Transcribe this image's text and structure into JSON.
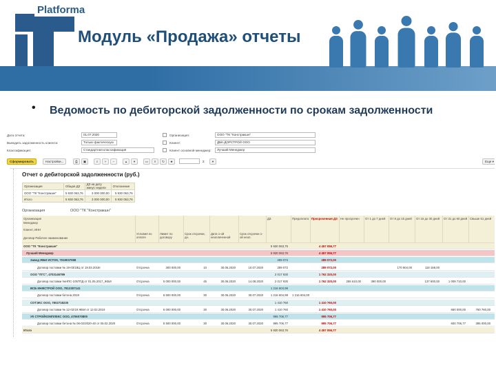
{
  "brand": "Platforma",
  "title": "Модуль «Продажа» отчеты",
  "bullet": "•",
  "subtitle": "Ведомость по дебиторской задолженности по срокам задолженности",
  "form": {
    "date_label": "Дата отчета:",
    "date_value": "01.07.2020",
    "debt_type_label": "Выводить задолженность клиента:",
    "debt_type_value": "Только фактическую",
    "class_label": "Классификация:",
    "class_value": "Стандартная классификация",
    "org_label": "Организация:",
    "org_value": "ООО \"ТК \"Констракшн\"",
    "client_label": "Клиент:",
    "client_value": "ДБК-ДОРСТРОЙ ООО",
    "manager_label": "Клиент основной менеджер:",
    "manager_value": "Лучший Менеджер"
  },
  "toolbar": {
    "generate": "Сформировать",
    "settings": "Настройки...",
    "sum_symbol": "Σ",
    "more": "Еще ▾",
    "icons": [
      "print-icon",
      "save-icon",
      "find-icon",
      "zoom-in-icon",
      "zoom-out-icon",
      "collapse-icon",
      "expand-icon",
      "folder-icon",
      "money-icon",
      "refresh-icon",
      "bookmark-icon"
    ]
  },
  "report": {
    "title": "Отчет о дебиторской задолженности (руб.)",
    "summary_headers": [
      "Организация",
      "Общая ДЗ",
      "ДЗ на дату минус недели",
      "Отклонение"
    ],
    "summary_rows": [
      [
        "ООО \"ТК \"Констракшн\"",
        "5 930 063,76",
        "3 000 000,00",
        "5 930 063,76"
      ],
      [
        "Итого",
        "5 930 063,76",
        "3 000 000,00",
        "5 930 063,76"
      ]
    ],
    "org2_label": "Организация",
    "org2_value": "ООО \"ТК \"Констракшн\"",
    "head_left": [
      "Организация",
      "Менеджер",
      "Клиент, ИНН",
      "Договор Рабочее наименование"
    ],
    "head_cols": [
      "Условия по оплате",
      "Лимит по договору",
      "Срок отсрочки, дн.",
      "Дата 1-ой неоплаченной",
      "Срок отсрочки 1-ой неоп.",
      "ДЗ",
      "Предоплата",
      "Просроченная ДЗ",
      "Не просрочен",
      "От 1 до 7 дней",
      "От 8 до 15 дней",
      "От 16 до 30 дней",
      "От 31 до 60 дней",
      "Свыше 61 дней"
    ],
    "rows": [
      {
        "kind": "total",
        "name": "ООО \"ТК \"Констракшн\"",
        "dz": "5 930 063,76",
        "overdue": "4 457 056,77"
      },
      {
        "kind": "mgr",
        "name": "Лучший Менеджер",
        "dz": "5 930 063,76",
        "overdue": "4 457 056,77"
      },
      {
        "kind": "cli",
        "name": "Завод ЖБИ ИСТОК, 7019037088",
        "dz": "289 072",
        "overdue": "289 072,00"
      },
      {
        "kind": "doc",
        "name": "Договор поставки № 19-03/18Ц от 19.03.2018г",
        "terms": "Отсрочка",
        "limit": "300 000,00",
        "days": "10",
        "date1": "30.06.2020",
        "due1": "10.07.2020",
        "dz": "289 072",
        "overdue": "289 072,00",
        "b2": "170 904,00",
        "b3": "118 168,00"
      },
      {
        "kind": "cli",
        "name": "ООО \"ПГС\", 4703146789",
        "dz": "2 017 930",
        "overdue": "1 762 320,00"
      },
      {
        "kind": "doc",
        "name": "Договор поставки №НПС-1057ПД от 01.05.2017_ЖБИ",
        "terms": "Отсрочка",
        "limit": "5 000 000,00",
        "days": "45",
        "date1": "30.06.2020",
        "due1": "14.08.2020",
        "dz": "2 017 930",
        "overdue": "1 762 320,00",
        "b0": "255 610,00",
        "b1": "390 000,00",
        "b3": "137 600,00",
        "b4": "1 009 710,00"
      },
      {
        "kind": "cli",
        "name": "ВСБ ИНЖСТРОЙ ООО, 7812307141",
        "dz": "1 216 604,99"
      },
      {
        "kind": "doc",
        "name": "Договор поставки бетона 2019",
        "terms": "Отсрочка",
        "limit": "6 500 000,00",
        "days": "30",
        "date1": "30.06.2020",
        "due1": "30.07.2020",
        "dz": "1 216 604,99",
        "pre": "1 216 604,00"
      },
      {
        "kind": "cli",
        "name": "СОТЭКС ООО, 7802718230",
        "dz": "1 410 760",
        "overdue": "1 410 760,00"
      },
      {
        "kind": "doc",
        "name": "Договор поставки № 12-02/19 ЖБИ от 12.02.2019",
        "terms": "Отсрочка",
        "limit": "5 000 000,00",
        "days": "30",
        "date1": "30.06.2020",
        "due1": "30.07.2020",
        "dz": "1 410 760",
        "overdue": "1 410 760,00",
        "b4": "650 000,00",
        "b5": "760 760,00"
      },
      {
        "kind": "cli",
        "name": "УК СТРОЙКОМПЛЕКС ООО, 4706070800",
        "dz": "995 706,77",
        "overdue": "995 706,77"
      },
      {
        "kind": "doc",
        "name": "Договор поставки бетона № 06-02/2020-40 от 06.02.2020",
        "terms": "Отсрочка",
        "limit": "5 500 000,00",
        "days": "30",
        "date1": "30.06.2020",
        "due1": "30.07.2020",
        "dz": "995 706,77",
        "overdue": "995 706,77",
        "b4": "600 706,77",
        "b5": "395 000,00"
      },
      {
        "kind": "total",
        "name": "Итого",
        "dz": "5 930 063,76",
        "overdue": "4 457 056,77"
      }
    ]
  },
  "colors": {
    "accent": "#2a5b8c",
    "title": "#1f4e79",
    "button": "#f4d545",
    "manager_row": "#f5c4c4",
    "client_row": "#bfe3ea",
    "header_row": "#f4f0d8"
  }
}
